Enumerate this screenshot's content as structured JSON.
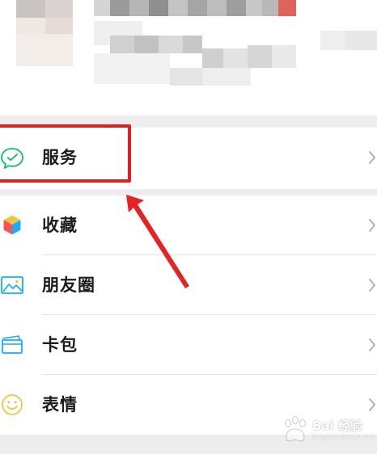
{
  "menu": {
    "primary": [
      {
        "label": "服务",
        "icon": "wechat-pay-icon"
      }
    ],
    "secondary": [
      {
        "label": "收藏",
        "icon": "favorites-cube-icon"
      },
      {
        "label": "朋友圈",
        "icon": "moments-photo-icon"
      },
      {
        "label": "卡包",
        "icon": "card-wallet-icon"
      },
      {
        "label": "表情",
        "icon": "sticker-smiley-icon"
      }
    ]
  },
  "annotation": {
    "highlight_color": "#e02020"
  },
  "watermark": {
    "text": "Bai 经验",
    "url": "jingyan.baidu.com"
  },
  "colors": {
    "background": "#ededed",
    "surface": "#ffffff",
    "text": "#1c1c1c",
    "chevron": "#b2b2b2",
    "wechat_green": "#07c160"
  }
}
